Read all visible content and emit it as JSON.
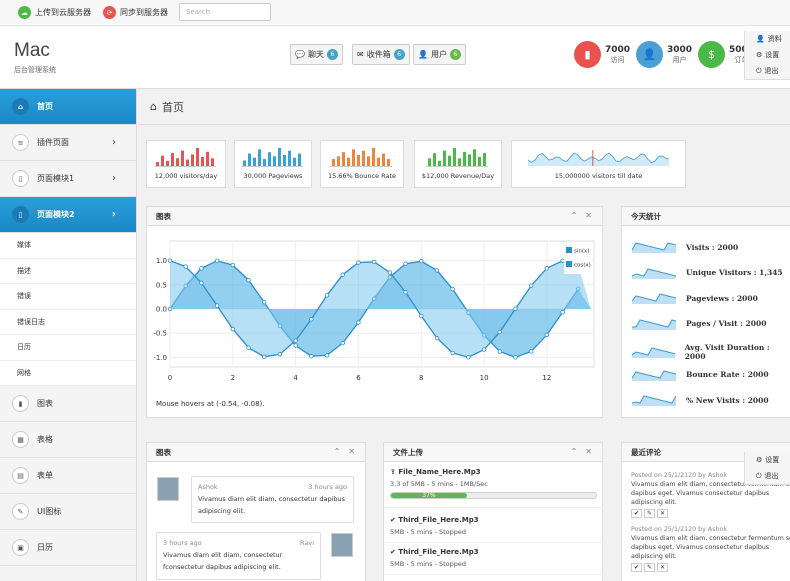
{
  "topbar": {
    "upload": "上传到云服务器",
    "sync": "同步到服务器",
    "search_placeholder": "Search"
  },
  "header": {
    "brand": "Mac",
    "subtitle": "后台管理系统",
    "buttons": [
      {
        "label": "聊天",
        "count": "6"
      },
      {
        "label": "收件箱",
        "count": "6"
      },
      {
        "label": "用户",
        "count": "6"
      }
    ],
    "stats": [
      {
        "value": "7000",
        "label": "访问",
        "color": "#e8524f"
      },
      {
        "value": "3000",
        "label": "用户",
        "color": "#4aa0d5"
      },
      {
        "value": "5000",
        "label": "订单",
        "color": "#4cb848"
      }
    ],
    "user_menu": [
      "资料",
      "设置",
      "退出"
    ]
  },
  "sidebar": {
    "items": [
      {
        "label": "首页",
        "active": true
      },
      {
        "label": "插件页面"
      },
      {
        "label": "页面模块1"
      },
      {
        "label": "页面模块2",
        "active": true
      }
    ],
    "sub": [
      "媒体",
      "描述",
      "错误",
      "错误日志",
      "日历",
      "网格"
    ],
    "more": [
      "图表",
      "表格",
      "表单",
      "UI图标",
      "日历"
    ]
  },
  "breadcrumb": "首页",
  "sparks": [
    {
      "label": "12,000 visitors/day",
      "color": "#e8524f",
      "values": [
        3,
        8,
        4,
        10,
        6,
        12,
        5,
        9,
        14,
        7,
        11,
        6
      ]
    },
    {
      "label": "30,000 Pageviews",
      "color": "#3aa0d5",
      "values": [
        4,
        9,
        6,
        12,
        5,
        10,
        7,
        13,
        8,
        11,
        6,
        9
      ]
    },
    {
      "label": "15.66% Bounce Rate",
      "color": "#f0843c",
      "values": [
        5,
        7,
        10,
        6,
        12,
        8,
        11,
        7,
        13,
        6,
        9,
        5
      ]
    },
    {
      "label": "$12,000 Revenue/Day",
      "color": "#4cb848",
      "values": [
        6,
        10,
        4,
        12,
        8,
        14,
        6,
        11,
        9,
        13,
        7,
        10
      ]
    },
    {
      "label": "15,000000 visitors till date",
      "color": "#3aa0d5"
    }
  ],
  "chart_panel": {
    "title": "图表",
    "status": "Mouse hovers at (-0.54, -0.08)."
  },
  "chart_data": {
    "type": "area",
    "title": "",
    "legend": [
      "sin(x)",
      "cos(x)"
    ],
    "legend_position": "top-right",
    "x_ticks": [
      0,
      2,
      4,
      6,
      8,
      10,
      12
    ],
    "y_ticks": [
      1.0,
      0.5,
      0.0,
      -0.5,
      -1.0
    ],
    "xlim": [
      0,
      13.5
    ],
    "ylim": [
      -1.2,
      1.2
    ],
    "grid": true
  },
  "today": {
    "title": "今天统计",
    "rows": [
      "Visits : 2000",
      "Unique Visitors : 1,345",
      "Pageviews : 2000",
      "Pages / Visit : 2000",
      "Avg. Visit Duration : 2000",
      "Bounce Rate : 2000",
      "% New Visits : 2000"
    ]
  },
  "chat": {
    "title": "图表",
    "messages": [
      {
        "name": "Ashok",
        "time": "3 hours ago",
        "text": "Vivamus diam elit diam, consectetur dapibus adipiscing elit."
      },
      {
        "name": "Ravi",
        "time": "3 hours ago",
        "text": "Vivamus diam elit diam, consectetur fconsectetur dapibus adipiscing elit."
      }
    ]
  },
  "upload": {
    "title": "文件上传",
    "files": [
      {
        "name": "File_Name_Here.Mp3",
        "meta": "3.3 of 5MB - 5 mins - 1MB/Sec",
        "progress": 0.37,
        "progress_label": "37%"
      },
      {
        "name": "Third_File_Here.Mp3",
        "meta": "5MB - 5 mins - Stopped"
      },
      {
        "name": "Third_File_Here.Mp3",
        "meta": "5MB - 5 mins - Stopped"
      }
    ]
  },
  "comments": {
    "title": "最近评论",
    "items": [
      {
        "posted": "Posted on 25/1/2120 by Ashok",
        "text": "Vivamus diam elit diam, consectetur fermentum sed dapibus eget, Vivamus consectetur dapibus adipiscing elit."
      },
      {
        "posted": "Posted on 25/1/2120 by Ashok",
        "text": "Vivamus diam elit diam, consectetur fermentum sed dapibus eget, Vivamus consectetur dapibus adipiscing elit."
      }
    ],
    "mini_menu": [
      "设置",
      "退出"
    ]
  }
}
